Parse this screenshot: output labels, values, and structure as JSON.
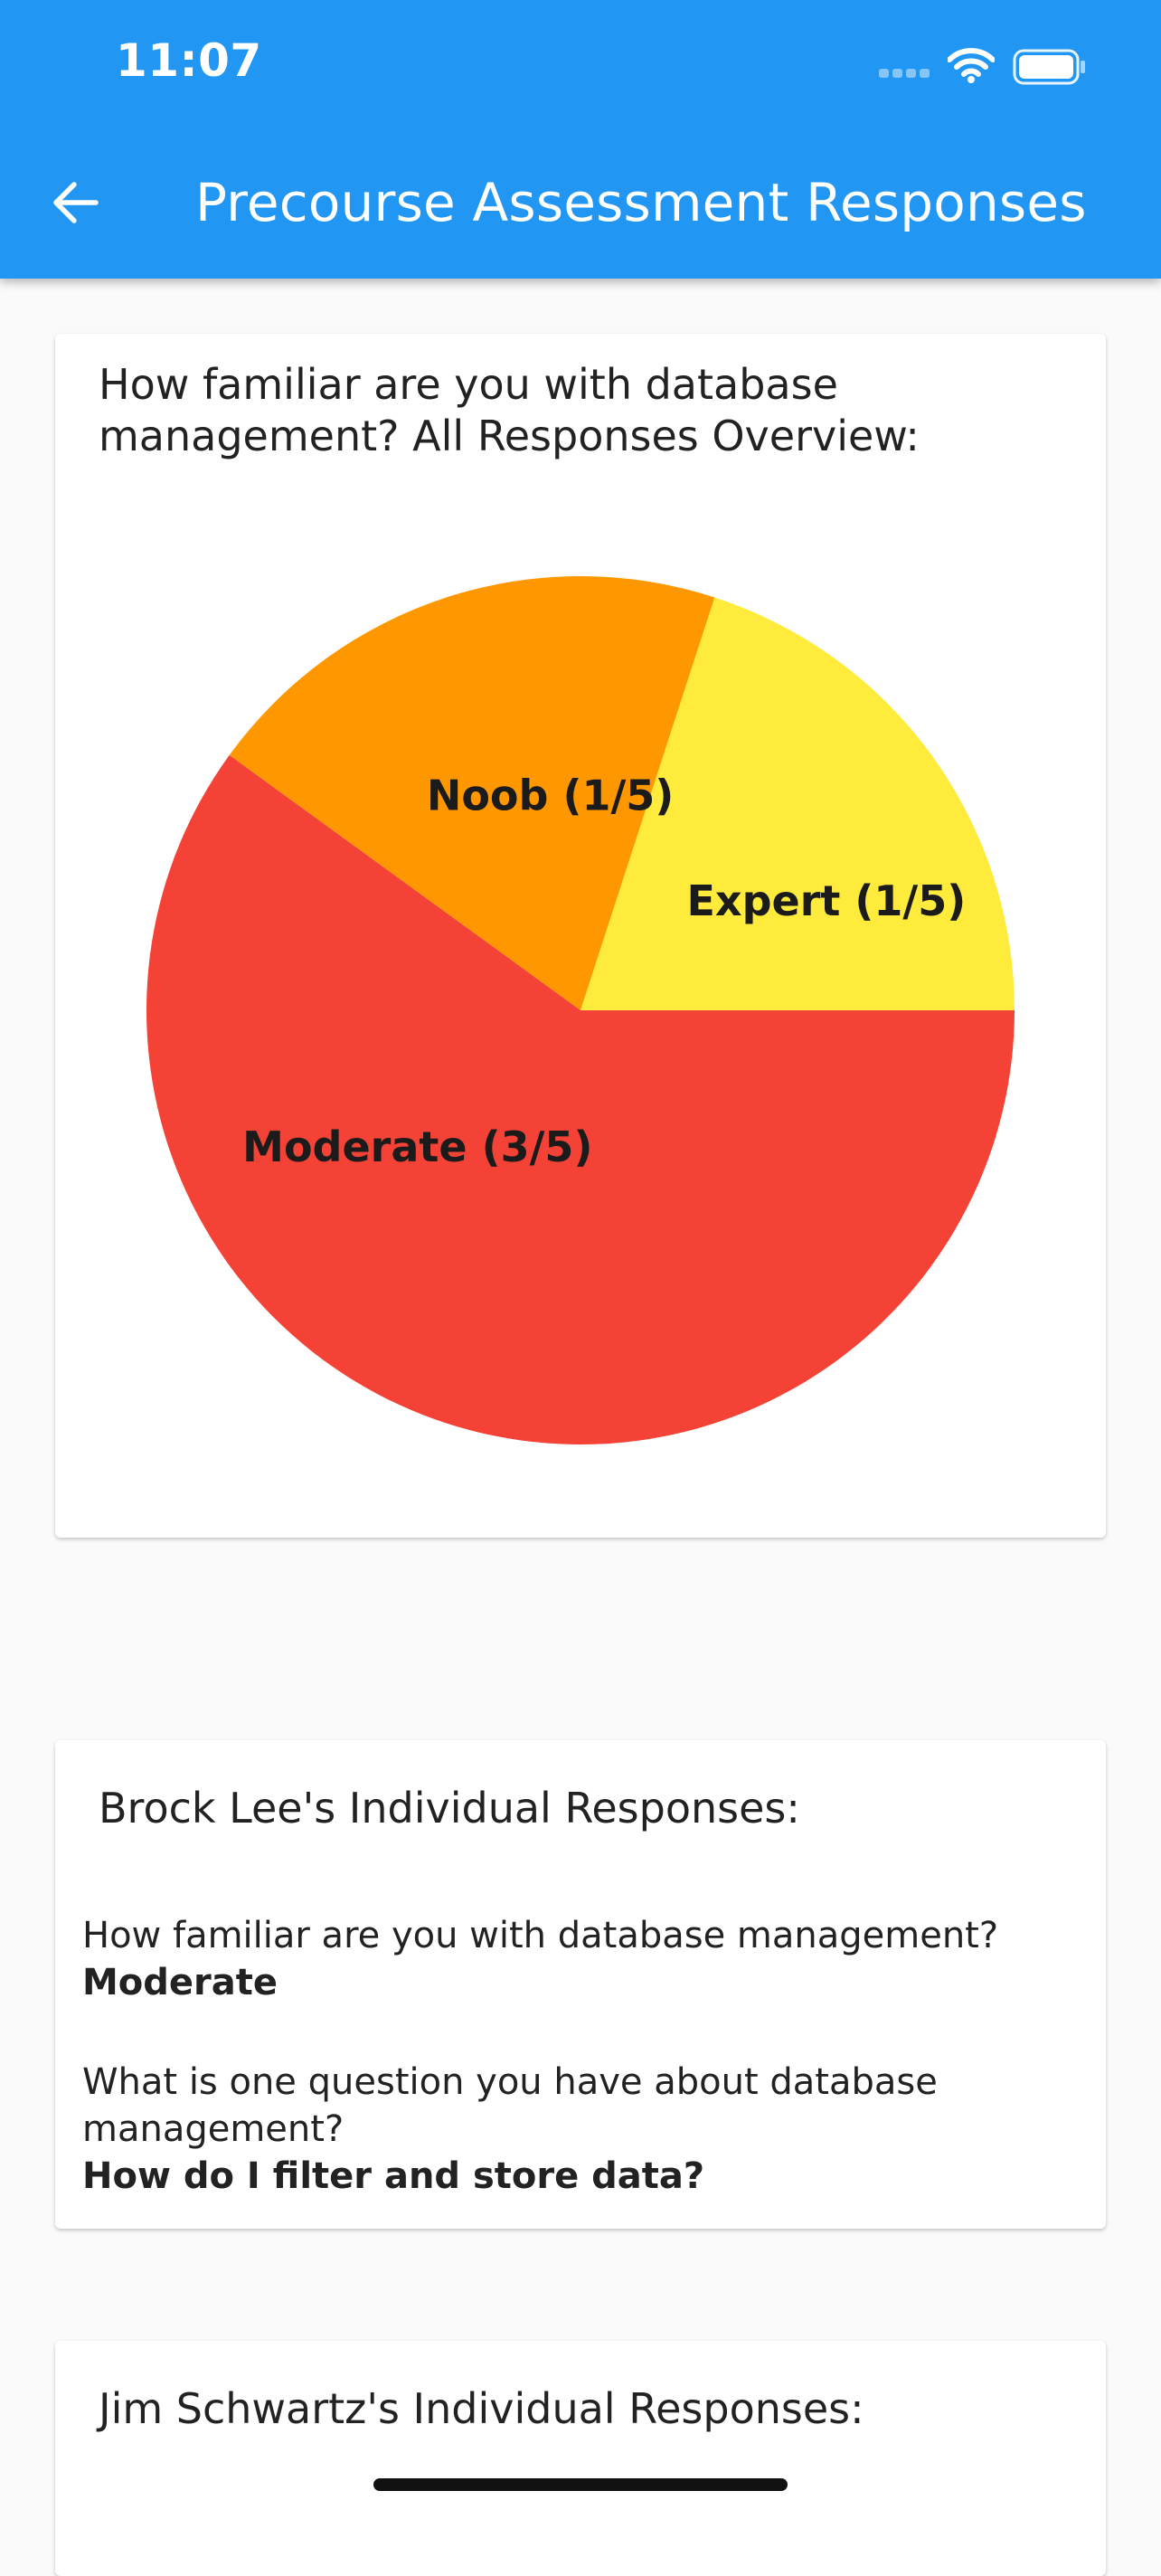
{
  "status_bar": {
    "time": "11:07"
  },
  "app_bar": {
    "title": "Precourse Assessment Responses"
  },
  "overview": {
    "question": "How familiar are you with database management? All Responses Overview:"
  },
  "chart_data": {
    "type": "pie",
    "slices": [
      {
        "label": "Expert (1/5)",
        "value": 1,
        "color": "#ffeb3b"
      },
      {
        "label": "Noob (1/5)",
        "value": 1,
        "color": "#ff9800"
      },
      {
        "label": "Moderate (3/5)",
        "value": 3,
        "color": "#f44336"
      }
    ]
  },
  "responses": [
    {
      "heading": "Brock Lee's Individual Responses:",
      "items": [
        {
          "question": "How familiar are you with database management?",
          "answer": "Moderate"
        },
        {
          "question": "What is one question you have about database management?",
          "answer": "How do I filter and store data?"
        }
      ]
    },
    {
      "heading": "Jim Schwartz's Individual Responses:"
    }
  ]
}
